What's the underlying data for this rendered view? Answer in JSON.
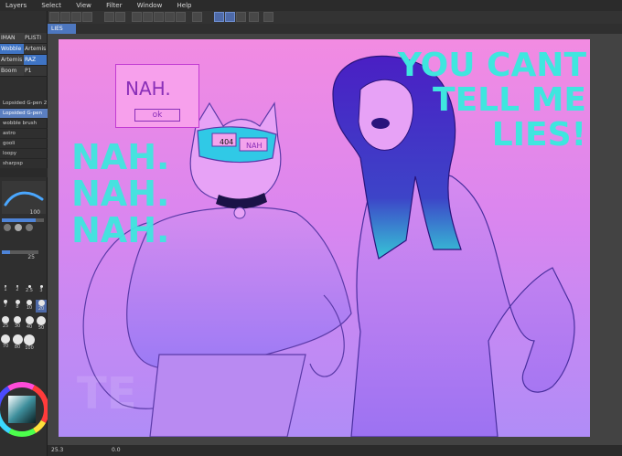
{
  "menu": [
    "Layers",
    "Select",
    "View",
    "Filter",
    "Window",
    "Help"
  ],
  "canvas_tab": "LIES",
  "left_panel": {
    "tool_tabs": [
      {
        "a": "IMAN",
        "b": "PLISTI"
      },
      {
        "a": "Wobble",
        "b": "Artemis",
        "sel": "a"
      },
      {
        "a": "Artemis",
        "b": "RAZ",
        "sel": "b"
      },
      {
        "a": "Boom",
        "b": "P1"
      }
    ],
    "brushes": [
      {
        "name": "Lopsided G-pen 2",
        "val": ""
      },
      {
        "name": "Lopsided G-pen",
        "val": "",
        "sel": true
      },
      {
        "name": "wobble brush",
        "val": ""
      },
      {
        "name": "astro",
        "val": ""
      },
      {
        "name": "gooli",
        "val": ""
      },
      {
        "name": "loopy",
        "val": ""
      },
      {
        "name": "sharpsp",
        "val": ""
      }
    ],
    "size_value": "100",
    "opacity_value": "25",
    "brush_sizes": [
      "1",
      "2",
      "2.5",
      "3",
      "7",
      "8",
      "10",
      "20",
      "25",
      "30",
      "40",
      "50",
      "70",
      "80",
      "100"
    ]
  },
  "artwork": {
    "text_left": "NAH.\nNAH.\nNAH.",
    "text_right": "YOU CANT\nTELL ME\nLIES!",
    "sign_top": "NAH.",
    "sign_ok": "ok",
    "visor_text": "404",
    "visor_tag": "NAH",
    "watermark": "TE"
  },
  "status": {
    "zoom": "25.3",
    "angle": "0.0"
  },
  "colors": {
    "accent": "#4e84d8",
    "cyan": "#3fe6df",
    "pink": "#f28be2"
  }
}
